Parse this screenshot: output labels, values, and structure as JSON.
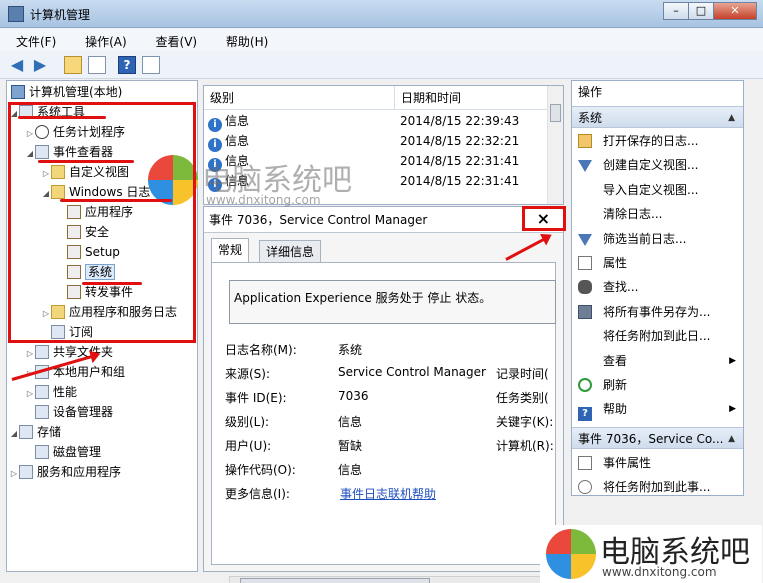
{
  "window": {
    "title": "计算机管理"
  },
  "menu": [
    "文件(F)",
    "操作(A)",
    "查看(V)",
    "帮助(H)"
  ],
  "tree": {
    "root": "计算机管理(本地)",
    "items": [
      {
        "label": "系统工具",
        "level": 1,
        "expander": "◢",
        "icon": "tools-icon"
      },
      {
        "label": "任务计划程序",
        "level": 2,
        "expander": "▷",
        "icon": "clock-icon"
      },
      {
        "label": "事件查看器",
        "level": 2,
        "expander": "◢",
        "icon": "event-viewer-icon"
      },
      {
        "label": "自定义视图",
        "level": 3,
        "expander": "▷",
        "icon": "folder-icon"
      },
      {
        "label": "Windows 日志",
        "level": 3,
        "expander": "◢",
        "icon": "folder-icon"
      },
      {
        "label": "应用程序",
        "level": 4,
        "expander": "",
        "icon": "log-icon"
      },
      {
        "label": "安全",
        "level": 4,
        "expander": "",
        "icon": "log-icon"
      },
      {
        "label": "Setup",
        "level": 4,
        "expander": "",
        "icon": "log-icon"
      },
      {
        "label": "系统",
        "level": 4,
        "expander": "",
        "icon": "log-icon",
        "selected": true
      },
      {
        "label": "转发事件",
        "level": 4,
        "expander": "",
        "icon": "log-icon"
      },
      {
        "label": "应用程序和服务日志",
        "level": 3,
        "expander": "▷",
        "icon": "folder-icon"
      },
      {
        "label": "订阅",
        "level": 3,
        "expander": "",
        "icon": "subscription-icon"
      },
      {
        "label": "共享文件夹",
        "level": 2,
        "expander": "▷",
        "icon": "shared-folder-icon"
      },
      {
        "label": "本地用户和组",
        "level": 2,
        "expander": "▷",
        "icon": "users-icon"
      },
      {
        "label": "性能",
        "level": 2,
        "expander": "▷",
        "icon": "performance-icon"
      },
      {
        "label": "设备管理器",
        "level": 2,
        "expander": "",
        "icon": "device-manager-icon"
      },
      {
        "label": "存储",
        "level": 1,
        "expander": "◢",
        "icon": "storage-icon"
      },
      {
        "label": "磁盘管理",
        "level": 2,
        "expander": "",
        "icon": "disk-icon"
      },
      {
        "label": "服务和应用程序",
        "level": 1,
        "expander": "▷",
        "icon": "services-icon"
      }
    ]
  },
  "events": {
    "columns": [
      "级别",
      "日期和时间"
    ],
    "rows": [
      {
        "level": "信息",
        "date": "2014/8/15 22:39:43"
      },
      {
        "level": "信息",
        "date": "2014/8/15 22:32:21"
      },
      {
        "level": "信息",
        "date": "2014/8/15 22:31:41"
      },
      {
        "level": "信息",
        "date": "2014/8/15 22:31:41"
      }
    ]
  },
  "detail": {
    "title": "事件 7036，Service Control Manager",
    "close": "×",
    "tabs": [
      "常规",
      "详细信息"
    ],
    "description": "Application Experience 服务处于 停止 状态。",
    "fields": {
      "log_name_label": "日志名称(M):",
      "log_name": "系统",
      "source_label": "来源(S):",
      "source": "Service Control Manager",
      "logged_label": "记录时间(",
      "event_id_label": "事件 ID(E):",
      "event_id": "7036",
      "task_label": "任务类别(",
      "level_label": "级别(L):",
      "level": "信息",
      "keywords_label": "关键字(K):",
      "user_label": "用户(U):",
      "user": "暂缺",
      "computer_label": "计算机(R):",
      "opcode_label": "操作代码(O):",
      "opcode": "信息",
      "more_label": "更多信息(I):",
      "more_link": "事件日志联机帮助"
    }
  },
  "actions": {
    "title": "操作",
    "group1": "系统",
    "items": [
      {
        "label": "打开保存的日志...",
        "icon": "folder-open-icon"
      },
      {
        "label": "创建自定义视图...",
        "icon": "filter-icon"
      },
      {
        "label": "导入自定义视图...",
        "icon": "blank-icon"
      },
      {
        "label": "清除日志...",
        "icon": "blank-icon"
      },
      {
        "label": "筛选当前日志...",
        "icon": "filter-icon"
      },
      {
        "label": "属性",
        "icon": "properties-icon"
      },
      {
        "label": "查找...",
        "icon": "find-icon"
      },
      {
        "label": "将所有事件另存为...",
        "icon": "save-icon"
      },
      {
        "label": "将任务附加到此日...",
        "icon": "blank-icon"
      },
      {
        "label": "查看",
        "icon": "blank-icon",
        "submenu": true
      },
      {
        "label": "刷新",
        "icon": "refresh-icon"
      },
      {
        "label": "帮助",
        "icon": "help-icon",
        "submenu": true
      }
    ],
    "group2": "事件 7036，Service Co...",
    "items2": [
      {
        "label": "事件属性",
        "icon": "properties-icon"
      },
      {
        "label": "将任务附加到此事...",
        "icon": "task-icon"
      }
    ]
  },
  "watermark": {
    "text": "电脑系统吧",
    "url": "www.dnxitong.com"
  }
}
